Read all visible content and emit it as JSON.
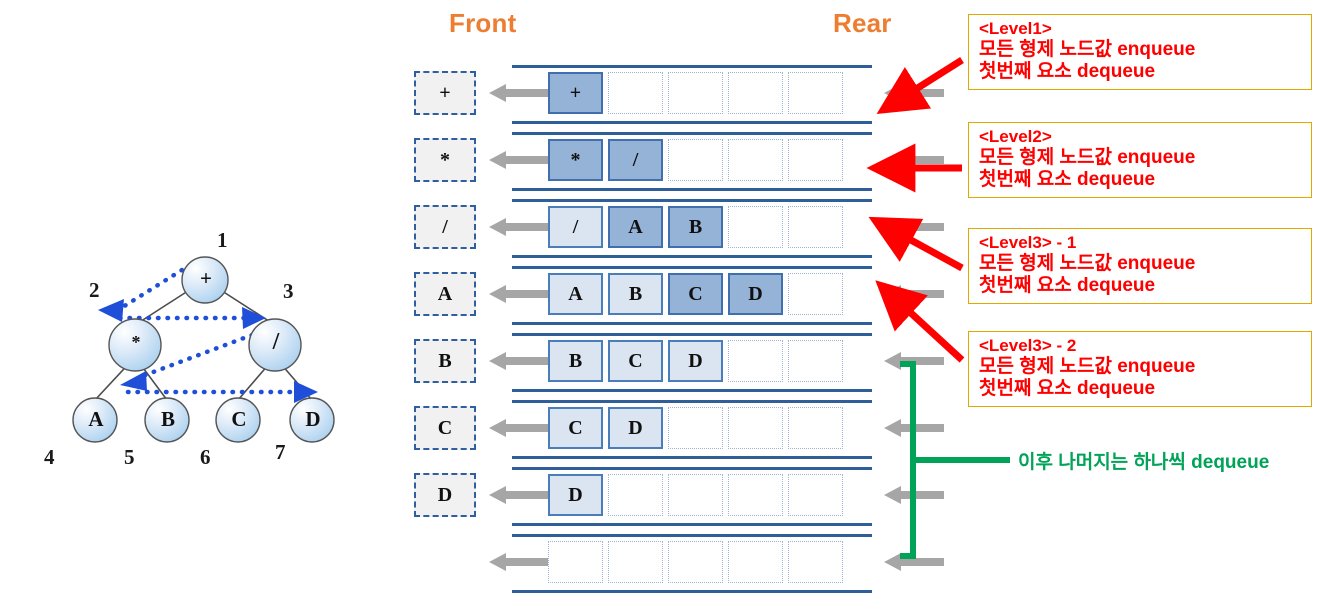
{
  "headers": {
    "front": "Front",
    "rear": "Rear"
  },
  "tree": {
    "nodes": [
      {
        "id": "root",
        "label": "+",
        "order": "1"
      },
      {
        "id": "mul",
        "label": "*",
        "order": "2"
      },
      {
        "id": "div",
        "label": "/",
        "order": "3"
      },
      {
        "id": "a",
        "label": "A",
        "order": "4"
      },
      {
        "id": "b",
        "label": "B",
        "order": "5"
      },
      {
        "id": "c",
        "label": "C",
        "order": "6"
      },
      {
        "id": "d",
        "label": "D",
        "order": "7"
      }
    ],
    "order_labels": [
      "1",
      "2",
      "3",
      "4",
      "5",
      "6",
      "7"
    ]
  },
  "queue_rows": [
    {
      "dequeued": "+",
      "cells": [
        {
          "value": "+",
          "state": "dark"
        },
        {
          "value": "",
          "state": "empty"
        },
        {
          "value": "",
          "state": "empty"
        },
        {
          "value": "",
          "state": "empty"
        },
        {
          "value": "",
          "state": "empty"
        }
      ]
    },
    {
      "dequeued": "*",
      "cells": [
        {
          "value": "*",
          "state": "dark"
        },
        {
          "value": "/",
          "state": "dark"
        },
        {
          "value": "",
          "state": "empty"
        },
        {
          "value": "",
          "state": "empty"
        },
        {
          "value": "",
          "state": "empty"
        }
      ]
    },
    {
      "dequeued": "/",
      "cells": [
        {
          "value": "/",
          "state": "light"
        },
        {
          "value": "A",
          "state": "dark"
        },
        {
          "value": "B",
          "state": "dark"
        },
        {
          "value": "",
          "state": "empty"
        },
        {
          "value": "",
          "state": "empty"
        }
      ]
    },
    {
      "dequeued": "A",
      "cells": [
        {
          "value": "A",
          "state": "light"
        },
        {
          "value": "B",
          "state": "light"
        },
        {
          "value": "C",
          "state": "dark"
        },
        {
          "value": "D",
          "state": "dark"
        },
        {
          "value": "",
          "state": "empty"
        }
      ]
    },
    {
      "dequeued": "B",
      "cells": [
        {
          "value": "B",
          "state": "light"
        },
        {
          "value": "C",
          "state": "light"
        },
        {
          "value": "D",
          "state": "light"
        },
        {
          "value": "",
          "state": "empty"
        },
        {
          "value": "",
          "state": "empty"
        }
      ]
    },
    {
      "dequeued": "C",
      "cells": [
        {
          "value": "C",
          "state": "light"
        },
        {
          "value": "D",
          "state": "light"
        },
        {
          "value": "",
          "state": "empty"
        },
        {
          "value": "",
          "state": "empty"
        },
        {
          "value": "",
          "state": "empty"
        }
      ]
    },
    {
      "dequeued": "D",
      "cells": [
        {
          "value": "D",
          "state": "light"
        },
        {
          "value": "",
          "state": "empty"
        },
        {
          "value": "",
          "state": "empty"
        },
        {
          "value": "",
          "state": "empty"
        },
        {
          "value": "",
          "state": "empty"
        }
      ]
    },
    {
      "dequeued": "",
      "cells": [
        {
          "value": "",
          "state": "empty"
        },
        {
          "value": "",
          "state": "empty"
        },
        {
          "value": "",
          "state": "empty"
        },
        {
          "value": "",
          "state": "empty"
        },
        {
          "value": "",
          "state": "empty"
        }
      ]
    }
  ],
  "notes": [
    {
      "title": "<Level1>",
      "line1": "모든 형제 노드값 enqueue",
      "line2": "첫번째 요소 dequeue"
    },
    {
      "title": "<Level2>",
      "line1": "모든 형제 노드값 enqueue",
      "line2": "첫번째 요소 dequeue"
    },
    {
      "title": "<Level3> - 1",
      "line1": "모든 형제 노드값 enqueue",
      "line2": "첫번째 요소 dequeue"
    },
    {
      "title": "<Level3> - 2",
      "line1": "모든 형제 노드값 enqueue",
      "line2": "첫번째 요소 dequeue"
    }
  ],
  "green_note": "이후 나머지는 하나씩 dequeue",
  "colors": {
    "accent_orange": "#ed7d31",
    "rail_blue": "#2e5f98",
    "cell_light": "#dbe5f1",
    "cell_dark": "#95b3d7",
    "note_border": "#e0a800",
    "note_text": "#ff0000",
    "green": "#00a357",
    "arrow_gray": "#a6a6a6",
    "traverse_blue": "#1f4fd8"
  }
}
